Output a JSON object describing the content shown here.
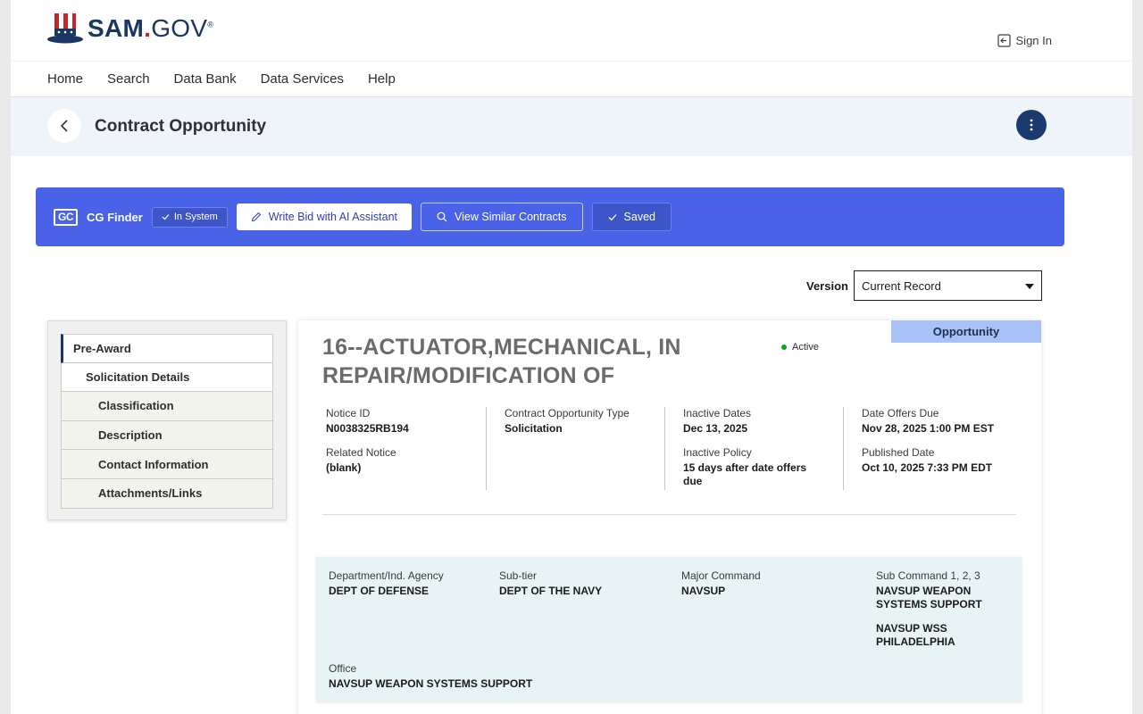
{
  "header": {
    "logo_text_bold": "SAM",
    "logo_text_dot": ".",
    "logo_text_gov": "GOV",
    "logo_reg": "®",
    "sign_in_label": "Sign In"
  },
  "nav": {
    "items": [
      {
        "label": "Home"
      },
      {
        "label": "Search"
      },
      {
        "label": "Data Bank"
      },
      {
        "label": "Data Services"
      },
      {
        "label": "Help"
      }
    ]
  },
  "titlebar": {
    "title": "Contract Opportunity"
  },
  "banner": {
    "logo_text": "GC",
    "label": "CG Finder",
    "in_system": "In System",
    "write_bid": "Write Bid with AI Assistant",
    "view_similar": "View Similar Contracts",
    "saved": "Saved"
  },
  "version": {
    "label": "Version",
    "selected": "Current Record"
  },
  "sidenav": {
    "items": [
      {
        "label": "Pre-Award"
      },
      {
        "label": "Solicitation Details"
      },
      {
        "label": "Classification"
      },
      {
        "label": "Description"
      },
      {
        "label": "Contact Information"
      },
      {
        "label": "Attachments/Links"
      }
    ]
  },
  "opportunity": {
    "tab": "Opportunity",
    "title": "16--ACTUATOR,MECHANICAL, IN REPAIR/MODIFICATION OF",
    "status": "Active",
    "status_color": "#00a91c",
    "fields": {
      "notice_id_label": "Notice ID",
      "notice_id": "N0038325RB194",
      "related_notice_label": "Related Notice",
      "related_notice": "(blank)",
      "type_label": "Contract Opportunity Type",
      "type": "Solicitation",
      "inactive_dates_label": "Inactive Dates",
      "inactive_dates": "Dec 13, 2025",
      "inactive_policy_label": "Inactive Policy",
      "inactive_policy": "15 days after date offers due",
      "offers_due_label": "Date Offers Due",
      "offers_due": "Nov 28, 2025 1:00 PM EST",
      "published_label": "Published Date",
      "published": "Oct 10, 2025 7:33 PM EDT"
    },
    "agency": {
      "department_label": "Department/Ind. Agency",
      "department": "DEPT OF DEFENSE",
      "subtier_label": "Sub-tier",
      "subtier": "DEPT OF THE NAVY",
      "major_command_label": "Major Command",
      "major_command": "NAVSUP",
      "sub_command_label": "Sub Command 1, 2, 3",
      "sub_command_1": "NAVSUP WEAPON SYSTEMS SUPPORT",
      "sub_command_2": "NAVSUP WSS PHILADELPHIA",
      "office_label": "Office",
      "office": "NAVSUP WEAPON SYSTEMS SUPPORT"
    }
  }
}
